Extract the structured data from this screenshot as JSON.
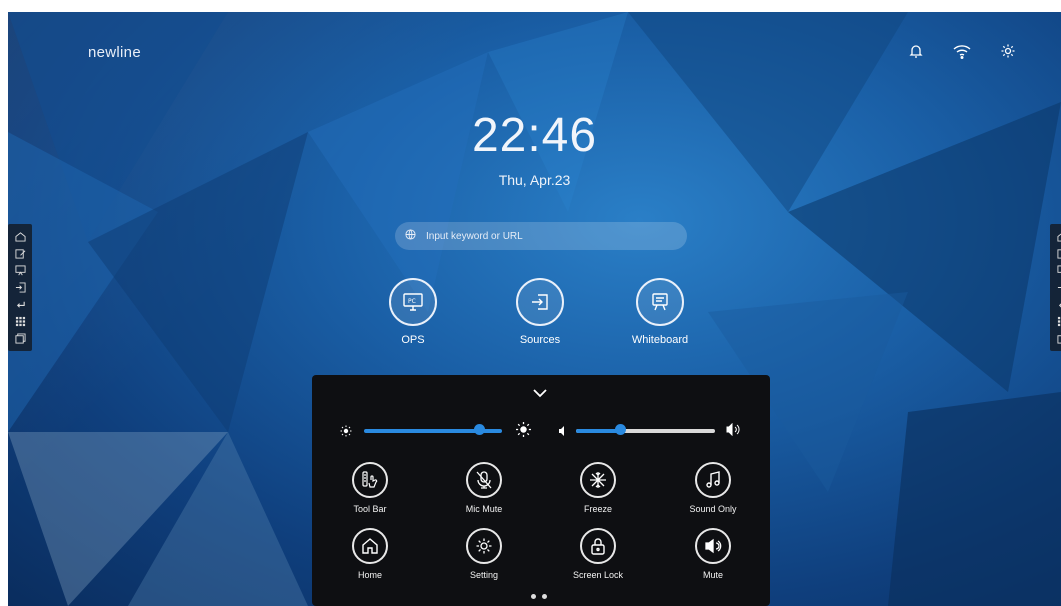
{
  "brand": "newline",
  "clock": {
    "time": "22:46",
    "date": "Thu, Apr.23"
  },
  "search": {
    "placeholder": "Input keyword or URL"
  },
  "apps": [
    {
      "label": "OPS",
      "icon": "pc-icon"
    },
    {
      "label": "Sources",
      "icon": "input-source-icon"
    },
    {
      "label": "Whiteboard",
      "icon": "whiteboard-icon"
    }
  ],
  "top_icons": [
    "bell-icon",
    "wifi-icon",
    "settings-gear-icon"
  ],
  "sidebar_icons": [
    "home-icon",
    "edit-icon",
    "whiteboard-icon",
    "input-source-icon",
    "back-icon",
    "apps-grid-icon",
    "window-icon"
  ],
  "quick_settings": {
    "brightness": 0.83,
    "volume": 0.32,
    "row1": [
      "Tool Bar",
      "Mic Mute",
      "Freeze",
      "Sound Only"
    ],
    "row2": [
      "Home",
      "Setting",
      "Screen Lock",
      "Mute"
    ],
    "page_indicator": {
      "current": 1,
      "total": 2
    }
  },
  "colors": {
    "accent": "#2a8ae0",
    "panel_bg": "#0e0f12",
    "bg_dark": "#0a2d5e",
    "bg_light": "#2a7fc7"
  }
}
